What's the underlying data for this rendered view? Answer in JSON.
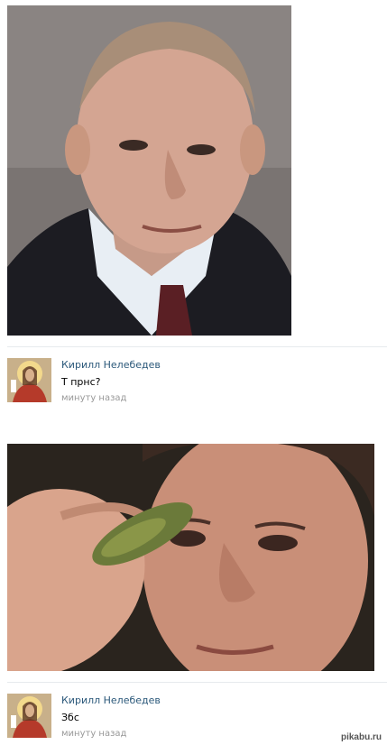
{
  "posts": [
    {
      "photo_label": "portrait-photo",
      "comment": {
        "author": "Кирилл Нелебедев",
        "text": "Т прнс?",
        "time": "минуту назад"
      }
    },
    {
      "photo_label": "closeup-photo",
      "comment": {
        "author": "Кирилл Нелебедев",
        "text": "Збс",
        "time": "минуту назад"
      }
    }
  ],
  "watermark": "pikabu.ru"
}
